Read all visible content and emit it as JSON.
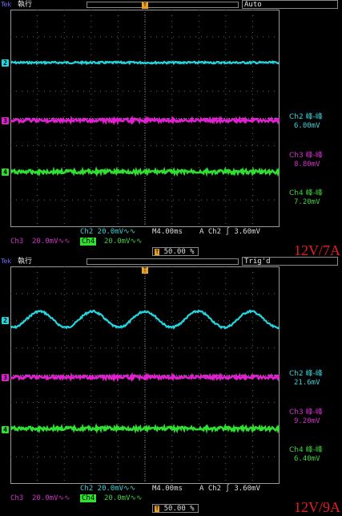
{
  "panels": [
    {
      "brand": "Tek",
      "run_state": "執行",
      "trigger_status": "Auto",
      "markers": [
        "2",
        "3",
        "4"
      ],
      "measurements": [
        {
          "name": "Ch2 峰-峰",
          "value": "6.00mV"
        },
        {
          "name": "Ch3 峰-峰",
          "value": "8.80mV"
        },
        {
          "name": "Ch4 峰-峰",
          "value": "7.20mV"
        }
      ],
      "ch2_scale": "Ch2  20.0mV∿∿",
      "timebase": "M4.00ms",
      "trig_source": "A  Ch2  ∫  3.60mV",
      "ch3_label": "Ch3",
      "ch3_scale": "20.0mV∿∿",
      "ch4_label": "Ch4",
      "ch4_scale": "20.0mV∿∿",
      "trig_pos": "50.00 %",
      "condition": "12V/7A"
    },
    {
      "brand": "Tek",
      "run_state": "執行",
      "trigger_status": "Trig'd",
      "markers": [
        "2",
        "3",
        "4"
      ],
      "measurements": [
        {
          "name": "Ch2 峰-峰",
          "value": "21.6mV"
        },
        {
          "name": "Ch3 峰-峰",
          "value": "9.20mV"
        },
        {
          "name": "Ch4 峰-峰",
          "value": "6.40mV"
        }
      ],
      "ch2_scale": "Ch2  20.0mV∿∿",
      "timebase": "M4.00ms",
      "trig_source": "A  Ch2  ∫  3.60mV",
      "ch3_label": "Ch3",
      "ch3_scale": "20.0mV∿∿",
      "ch4_label": "Ch4",
      "ch4_scale": "20.0mV∿∿",
      "trig_pos": "50.00 %",
      "condition": "12V/9A"
    }
  ],
  "colors": {
    "ch2": "#22d8e0",
    "ch3": "#e020d0",
    "ch4": "#30e030",
    "trigger": "#f0a020",
    "condition_label": "#e02020"
  },
  "icons": {
    "trigger_marker": "T-trigger-icon",
    "channel_marker": "channel-ground-marker-icon"
  }
}
